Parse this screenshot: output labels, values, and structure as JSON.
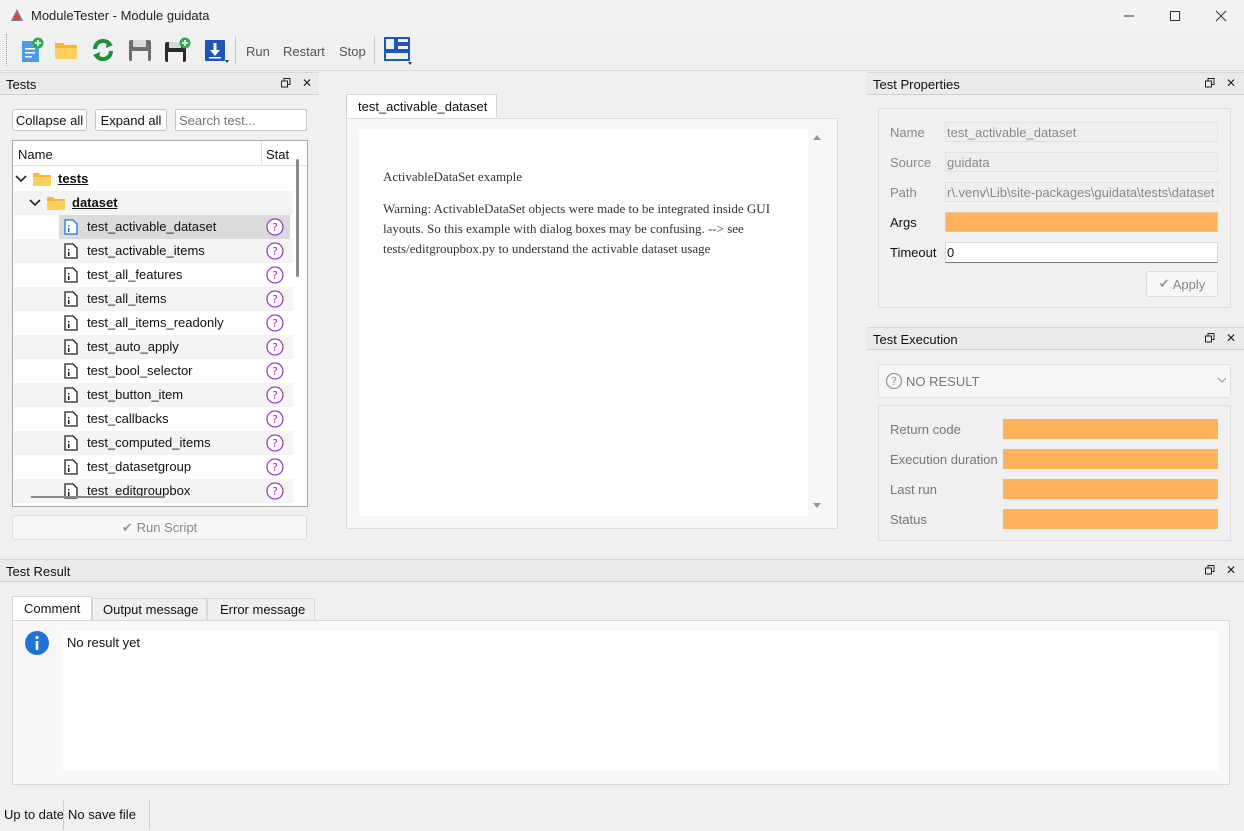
{
  "window": {
    "title": "ModuleTester - Module guidata"
  },
  "toolbar": {
    "icons": [
      "new-file-icon",
      "open-folder-icon",
      "refresh-icon",
      "save-icon",
      "save-add-icon",
      "download-icon",
      "layout-icon"
    ],
    "run_label": "Run",
    "restart_label": "Restart",
    "stop_label": "Stop"
  },
  "tests_panel": {
    "title": "Tests",
    "collapse_label": "Collapse all",
    "expand_label": "Expand all",
    "search_placeholder": "Search test...",
    "col_name": "Name",
    "col_status": "Stat",
    "root_folder": "tests",
    "sub_folder": "dataset",
    "items": [
      "test_activable_dataset",
      "test_activable_items",
      "test_all_features",
      "test_all_items",
      "test_all_items_readonly",
      "test_auto_apply",
      "test_bool_selector",
      "test_button_item",
      "test_callbacks",
      "test_computed_items",
      "test_datasetgroup",
      "test_editgroupbox"
    ],
    "selected_index": 0,
    "run_script_label": "Run Script"
  },
  "editor": {
    "tab_label": "test_activable_dataset",
    "heading": "ActivableDataSet example",
    "body": "Warning: ActivableDataSet objects were made to be integrated inside GUI layouts. So this example with dialog boxes may be confusing. --> see tests/editgroupbox.py to understand the activable dataset usage"
  },
  "properties": {
    "title": "Test Properties",
    "name_label": "Name",
    "name_value": "test_activable_dataset",
    "source_label": "Source",
    "source_value": "guidata",
    "path_label": "Path",
    "path_value": "r\\.venv\\Lib\\site-packages\\guidata\\tests\\dataset",
    "args_label": "Args",
    "args_value": "",
    "timeout_label": "Timeout",
    "timeout_value": "0",
    "apply_label": "Apply"
  },
  "execution": {
    "title": "Test Execution",
    "result_label": "NO RESULT",
    "return_code_label": "Return code",
    "duration_label": "Execution duration",
    "last_run_label": "Last run",
    "status_label": "Status",
    "highlight_color": "#ffb15c"
  },
  "result": {
    "title": "Test Result",
    "tabs": [
      "Comment",
      "Output message",
      "Error message"
    ],
    "message": "No result yet"
  },
  "statusbar": {
    "left": "Up to date",
    "right": "No save file"
  },
  "colors": {
    "accent": "#1f73d6",
    "folder": "#f6b830",
    "status_purple": "#9a3cc4",
    "selection": "#dbdbdb"
  }
}
